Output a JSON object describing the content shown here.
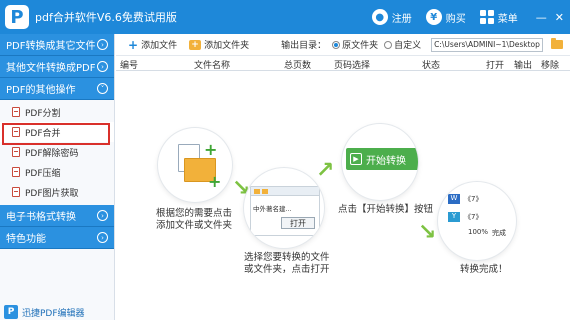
{
  "app": {
    "title": "pdf合并软件V6.6免费试用版",
    "logo_glyph": "P",
    "actions": {
      "register_label": "注册",
      "buy_label": "购买",
      "menu_label": "菜单"
    },
    "window": {
      "minimize": "—",
      "close": "✕"
    }
  },
  "sidebar": {
    "sections": [
      {
        "label": "PDF转换成其它文件"
      },
      {
        "label": "其他文件转换成PDF"
      },
      {
        "label": "PDF的其他操作"
      }
    ],
    "sub_items": [
      {
        "label": "PDF分割"
      },
      {
        "label": "PDF合并",
        "active": true
      },
      {
        "label": "PDF解除密码"
      },
      {
        "label": "PDF压缩"
      },
      {
        "label": "PDF图片获取"
      }
    ],
    "sections_after": [
      {
        "label": "电子书格式转换"
      },
      {
        "label": "特色功能"
      }
    ],
    "promo_label": "迅捷PDF编辑器"
  },
  "toolbar": {
    "add_file_label": "添加文件",
    "add_folder_label": "添加文件夹",
    "output_dir_label": "输出目录：",
    "radio_original": "原文件夹",
    "radio_custom": "自定义",
    "path_value": "C:\\Users\\ADMINI~1\\Desktop\\"
  },
  "table": {
    "columns": [
      "编号",
      "文件名称",
      "总页数",
      "页码选择",
      "状态",
      "打开",
      "输出",
      "移除"
    ]
  },
  "guide": {
    "step1_text_1": "根据您的需要点击",
    "step1_text_2": "添加文件或文件夹",
    "step2_text_1": "选择您要转换的文件",
    "step2_text_2": "或文件夹，点击打开",
    "step2_file_label": "中外著名建...",
    "step2_open_label": "打开",
    "step3_text": "点击【开始转换】按钮",
    "step3_button_label": "开始转换",
    "step4_text": "转换完成！",
    "step4_row1": "《7》",
    "step4_row2": "《7》",
    "step4_progress": "100%",
    "step4_done": "完成"
  }
}
